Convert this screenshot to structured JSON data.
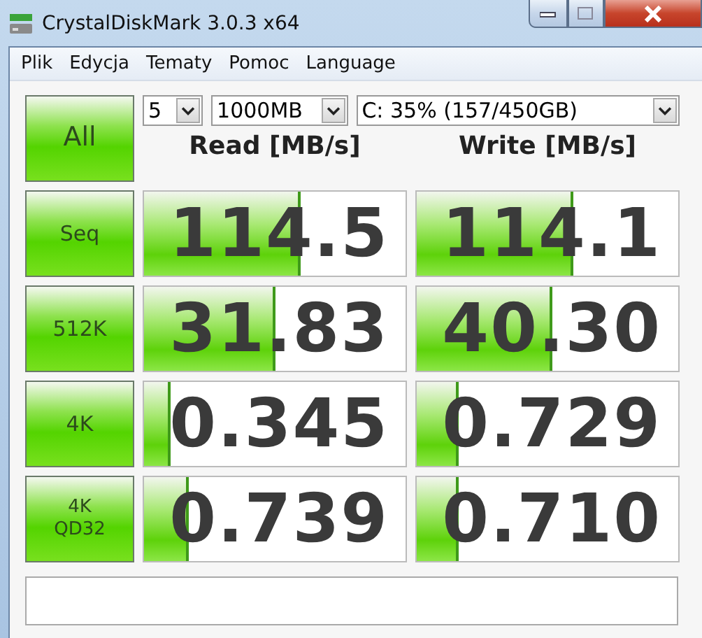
{
  "window": {
    "title": "CrystalDiskMark 3.0.3 x64"
  },
  "menu": [
    {
      "label": "Plik"
    },
    {
      "label": "Edycja"
    },
    {
      "label": "Tematy"
    },
    {
      "label": "Pomoc"
    },
    {
      "label": "Language"
    }
  ],
  "all_button": {
    "label": "All"
  },
  "selectors": [
    {
      "value": "5"
    },
    {
      "value": "1000MB"
    },
    {
      "value": "C: 35% (157/450GB)"
    }
  ],
  "columns": [
    "Read [MB/s]",
    "Write [MB/s]"
  ],
  "tests": [
    {
      "label": "Seq",
      "read": {
        "value": "114.5",
        "level": 0.6
      },
      "write": {
        "value": "114.1",
        "level": 0.6
      }
    },
    {
      "label": "512K",
      "read": {
        "value": "31.83",
        "level": 0.5
      },
      "write": {
        "value": "40.30",
        "level": 0.52
      }
    },
    {
      "label": "4K",
      "read": {
        "value": "0.345",
        "level": 0.1
      },
      "write": {
        "value": "0.729",
        "level": 0.16
      }
    },
    {
      "label": "4K\nQD32",
      "read": {
        "value": "0.739",
        "level": 0.17
      },
      "write": {
        "value": "0.710",
        "level": 0.16
      }
    }
  ]
}
